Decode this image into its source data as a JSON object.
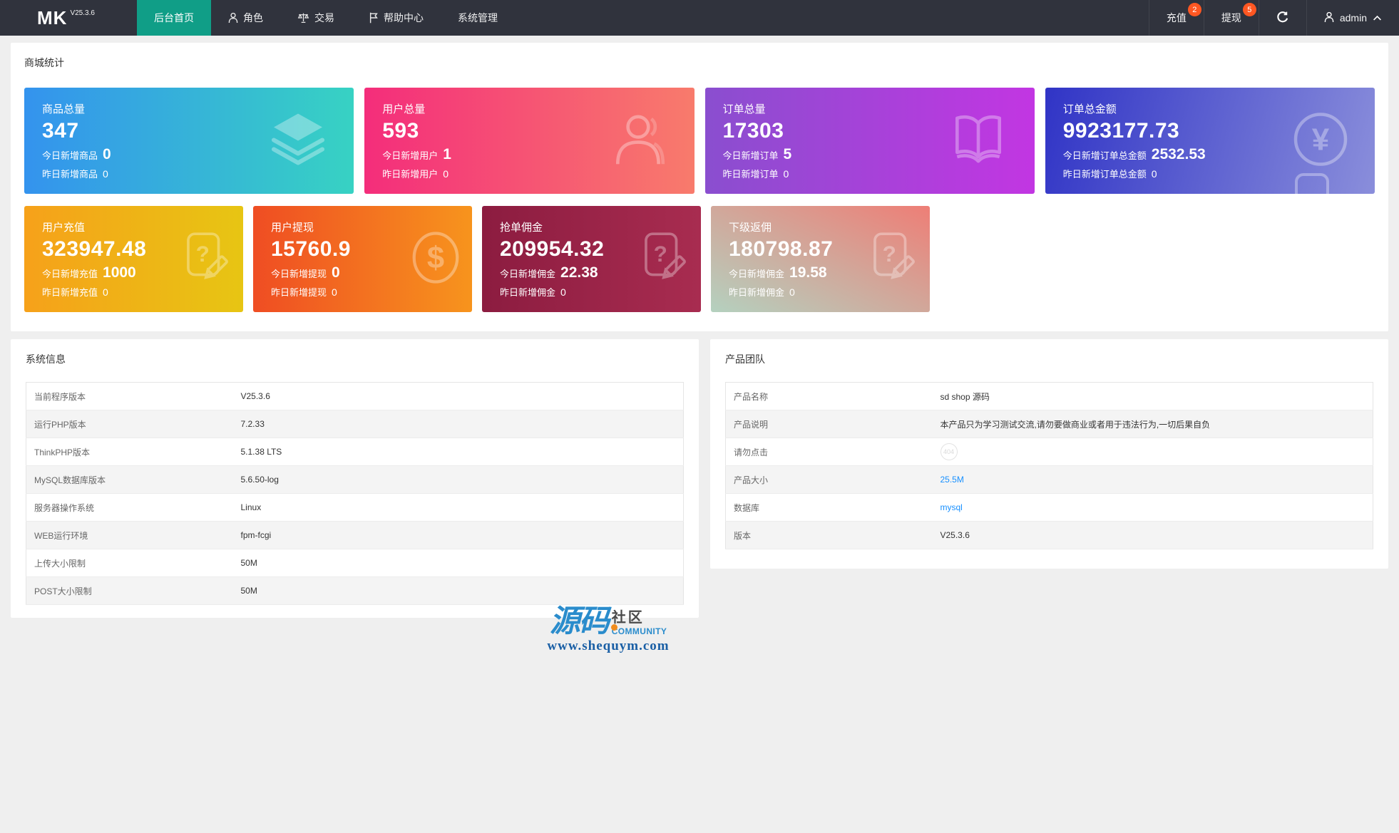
{
  "navbar": {
    "logo": {
      "text": "MK",
      "version": "V25.3.6"
    },
    "menu": [
      {
        "label": "后台首页",
        "active": true
      },
      {
        "label": "角色",
        "icon": "person-icon"
      },
      {
        "label": "交易",
        "icon": "scales-icon"
      },
      {
        "label": "帮助中心",
        "icon": "flag-icon"
      },
      {
        "label": "系统管理"
      }
    ],
    "actions": {
      "recharge": {
        "label": "充值",
        "badge": "2"
      },
      "withdraw": {
        "label": "提现",
        "badge": "5"
      },
      "refresh_icon": "refresh-icon",
      "username": "admin"
    }
  },
  "stats": {
    "title": "商城统计",
    "row1": [
      {
        "label": "商品总量",
        "value": "347",
        "today_label": "今日新增商品",
        "today_value": "0",
        "yesterday_label": "昨日新增商品",
        "yesterday_value": "0",
        "icon": "layers-icon",
        "gradient": [
          "#3493ee",
          "#37d2c3"
        ]
      },
      {
        "label": "用户总量",
        "value": "593",
        "today_label": "今日新增用户",
        "today_value": "1",
        "yesterday_label": "昨日新增用户",
        "yesterday_value": "0",
        "icon": "user-icon",
        "gradient": [
          "#f42d7b",
          "#f87b6c"
        ]
      },
      {
        "label": "订单总量",
        "value": "17303",
        "today_label": "今日新增订单",
        "today_value": "5",
        "yesterday_label": "昨日新增订单",
        "yesterday_value": "0",
        "icon": "book-icon",
        "gradient": [
          "#8a4ecf",
          "#c236e2"
        ]
      },
      {
        "label": "订单总金额",
        "value": "9923177.73",
        "today_label": "今日新增订单总金额",
        "today_value": "2532.53",
        "yesterday_label": "昨日新增订单总金额",
        "yesterday_value": "0",
        "icon": "yen-circle-icon",
        "gradient": [
          "#3034c6",
          "#8a8edb"
        ]
      }
    ],
    "row2": [
      {
        "label": "用户充值",
        "value": "323947.48",
        "today_label": "今日新增充值",
        "today_value": "1000",
        "yesterday_label": "昨日新增充值",
        "yesterday_value": "0",
        "icon": "doc-question-pencil-icon",
        "gradient": [
          "#f6a11a",
          "#e7c513"
        ]
      },
      {
        "label": "用户提现",
        "value": "15760.9",
        "today_label": "今日新增提现",
        "today_value": "0",
        "yesterday_label": "昨日新增提现",
        "yesterday_value": "0",
        "icon": "dollar-circle-icon",
        "gradient": [
          "#ef4d23",
          "#f7941d"
        ]
      },
      {
        "label": "抢单佣金",
        "value": "209954.32",
        "today_label": "今日新增佣金",
        "today_value": "22.38",
        "yesterday_label": "昨日新增佣金",
        "yesterday_value": "0",
        "icon": "doc-question-pencil-icon",
        "gradient": [
          "#8c1c40",
          "#a82c50"
        ]
      },
      {
        "label": "下级返佣",
        "value": "180798.87",
        "today_label": "今日新增佣金",
        "today_value": "19.58",
        "yesterday_label": "昨日新增佣金",
        "yesterday_value": "0",
        "icon": "doc-question-pencil-icon",
        "gradient": [
          "#b4d1bf",
          "#ee7e76"
        ]
      }
    ]
  },
  "system_info": {
    "title": "系统信息",
    "rows": [
      {
        "label": "当前程序版本",
        "value": "V25.3.6"
      },
      {
        "label": "运行PHP版本",
        "value": "7.2.33"
      },
      {
        "label": "ThinkPHP版本",
        "value": "5.1.38 LTS"
      },
      {
        "label": "MySQL数据库版本",
        "value": "5.6.50-log"
      },
      {
        "label": "服务器操作系统",
        "value": "Linux"
      },
      {
        "label": "WEB运行环境",
        "value": "fpm-fcgi"
      },
      {
        "label": "上传大小限制",
        "value": "50M"
      },
      {
        "label": "POST大小限制",
        "value": "50M"
      }
    ]
  },
  "product_team": {
    "title": "产品团队",
    "rows": [
      {
        "label": "产品名称",
        "value": "sd shop 源码"
      },
      {
        "label": "产品说明",
        "value": "本产品只为学习测试交流,请勿要做商业或者用于违法行为,一切后果自负"
      },
      {
        "label": "请勿点击",
        "value": "404"
      },
      {
        "label": "产品大小",
        "value": "25.5M",
        "is_link": true
      },
      {
        "label": "数据库",
        "value": "mysql",
        "is_link": true
      },
      {
        "label": "版本",
        "value": "V25.3.6"
      }
    ]
  },
  "watermark": {
    "cn_primary": "源码",
    "cn_secondary": "社区",
    "en": "COMMUNITY",
    "url": "www.shequym.com"
  },
  "colors": {
    "navbar_bg": "#30333d",
    "active_tab": "#109e87",
    "badge": "#ff5722",
    "link": "#1890ff",
    "page_bg": "#efefef",
    "stripe": "#f4f4f4"
  }
}
